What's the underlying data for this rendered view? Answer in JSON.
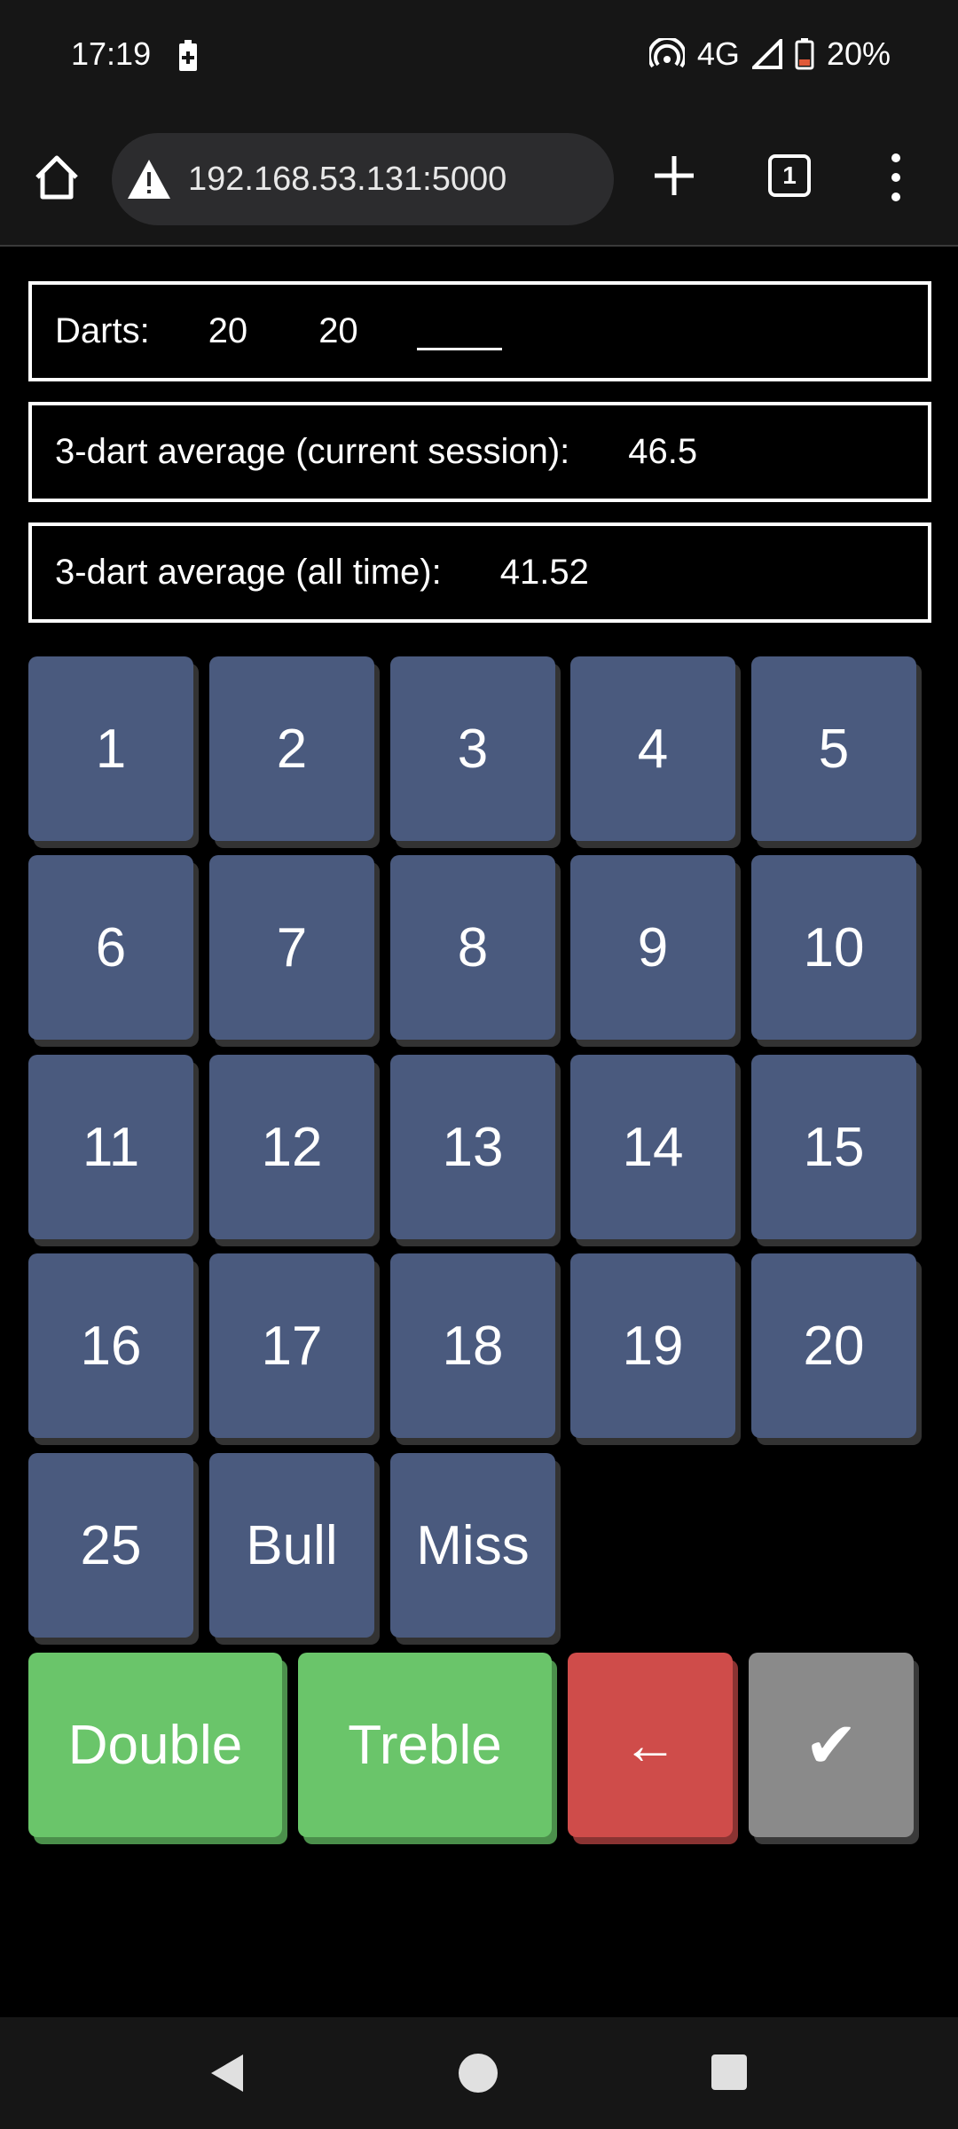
{
  "status_bar": {
    "time": "17:19",
    "network": "4G",
    "battery": "20%"
  },
  "browser": {
    "url": "192.168.53.131:5000",
    "tab_count": "1"
  },
  "darts_panel": {
    "label": "Darts:",
    "dart1": "20",
    "dart2": "20"
  },
  "session_panel": {
    "label": "3-dart average (current session):",
    "value": "46.5"
  },
  "alltime_panel": {
    "label": "3-dart average (all time):",
    "value": "41.52"
  },
  "keypad": {
    "keys": [
      "1",
      "2",
      "3",
      "4",
      "5",
      "6",
      "7",
      "8",
      "9",
      "10",
      "11",
      "12",
      "13",
      "14",
      "15",
      "16",
      "17",
      "18",
      "19",
      "20",
      "25",
      "Bull",
      "Miss"
    ]
  },
  "actions": {
    "double": "Double",
    "treble": "Treble",
    "backspace": "←",
    "submit": "✔"
  },
  "colors": {
    "key": "#4a5a7e",
    "double_treble": "#6ac56a",
    "backspace": "#cf4c4a",
    "submit": "#8a8a8a"
  }
}
